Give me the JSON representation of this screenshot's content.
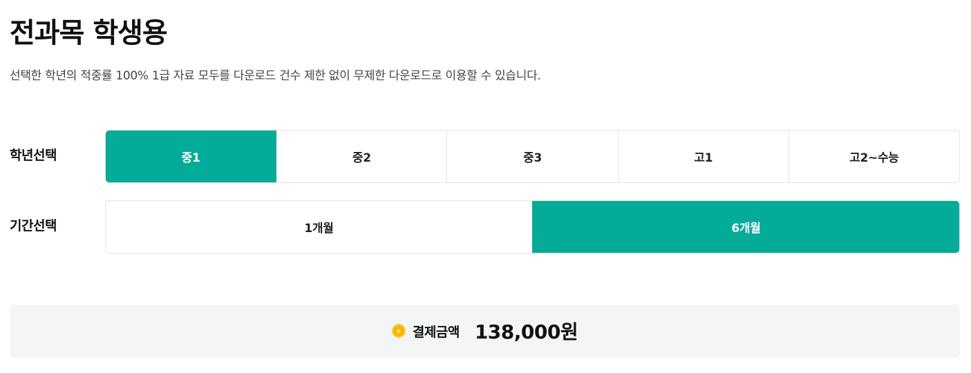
{
  "header": {
    "title": "전과목 학생용",
    "subtitle": "선택한 학년의 적중률 100% 1급 자료 모두를 다운로드 건수 제한 없이 무제한 다운로드로 이용할 수 있습니다."
  },
  "grade_select": {
    "label": "학년선택",
    "options": [
      {
        "label": "중1",
        "selected": true
      },
      {
        "label": "중2",
        "selected": false
      },
      {
        "label": "중3",
        "selected": false
      },
      {
        "label": "고1",
        "selected": false
      },
      {
        "label": "고2~수능",
        "selected": false
      }
    ]
  },
  "period_select": {
    "label": "기간선택",
    "options": [
      {
        "label": "1개월",
        "selected": false
      },
      {
        "label": "6개월",
        "selected": true
      }
    ]
  },
  "payment": {
    "icon": "coin-icon",
    "label": "결제금액",
    "amount": "138,000원"
  },
  "colors": {
    "accent": "#04ab98",
    "coin": "#f7b500",
    "panel_bg": "#f4f5f5"
  }
}
